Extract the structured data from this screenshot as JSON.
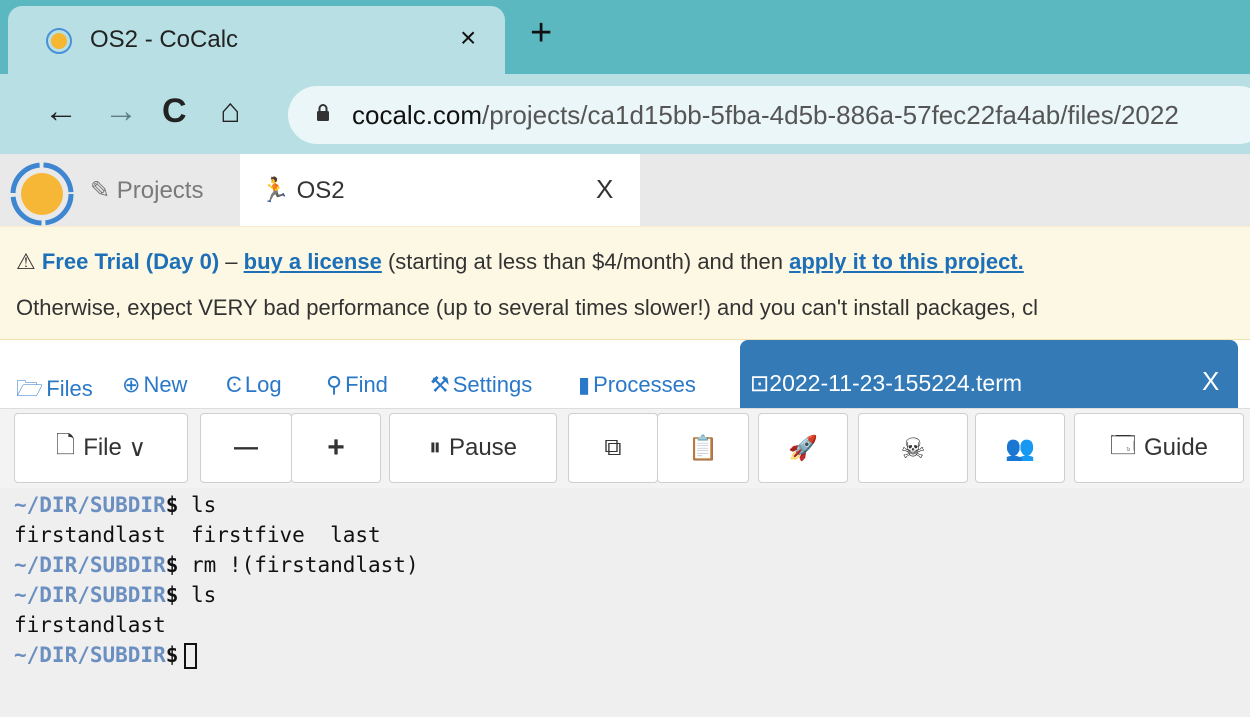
{
  "browser": {
    "tab_title": "OS2 - CoCalc",
    "tab_close": "×",
    "new_tab": "+",
    "nav": {
      "back": "←",
      "forward": "→",
      "reload": "C",
      "home": "⌂"
    },
    "url_host": "cocalc.com",
    "url_path": "/projects/ca1d15bb-5fba-4d5b-886a-57fec22fa4ab/files/2022"
  },
  "cocalc": {
    "projects_label": "Projects",
    "project_tab_name": "OS2",
    "project_tab_close": "X"
  },
  "banner": {
    "warning_icon": "⚠",
    "trial": "Free Trial (Day 0)",
    "dash": " – ",
    "buy_link": "buy a license",
    "mid_text": " (starting at less than $4/month) and then ",
    "apply_link": "apply it to this project.",
    "line2": "Otherwise, expect VERY bad performance (up to several times slower!) and you can't install packages, cl"
  },
  "project_tabs": [
    {
      "icon": "folder-icon",
      "glyph": "🗁",
      "label": "Files"
    },
    {
      "icon": "plus-circle-icon",
      "glyph": "⊕",
      "label": "New"
    },
    {
      "icon": "history-icon",
      "glyph": "Ͼ",
      "label": "Log"
    },
    {
      "icon": "search-icon",
      "glyph": "🔍",
      "label": "Find"
    },
    {
      "icon": "wrench-icon",
      "glyph": "🔧",
      "label": "Settings"
    },
    {
      "icon": "microchip-icon",
      "glyph": "▮",
      "label": "Processes"
    }
  ],
  "file_tab": {
    "icon": "terminal-icon",
    "glyph": "⊡",
    "name": "2022-11-23-155224.term",
    "close": "X"
  },
  "terminal_buttons": {
    "file": "File",
    "file_caret": "∨",
    "decrease": "—",
    "increase": "+",
    "pause": "Pause",
    "guide": "Guide"
  },
  "terminal": {
    "lines": [
      {
        "prompt": "~/DIR/SUBDIR",
        "dollar": "$",
        "cmd": " ls"
      },
      {
        "output": "firstandlast  firstfive  last"
      },
      {
        "prompt": "~/DIR/SUBDIR",
        "dollar": "$",
        "cmd": " rm !(firstandlast)"
      },
      {
        "prompt": "~/DIR/SUBDIR",
        "dollar": "$",
        "cmd": " ls"
      },
      {
        "output": "firstandlast"
      },
      {
        "prompt": "~/DIR/SUBDIR",
        "dollar": "$",
        "cmd": ""
      }
    ]
  },
  "colors": {
    "tabstrip": "#5bb8c0",
    "toolbar": "#b8e0e4",
    "link_blue": "#2a78c8",
    "active_tab": "#337ab7",
    "banner": "#fcf8e3",
    "prompt": "#6a8fc0"
  }
}
